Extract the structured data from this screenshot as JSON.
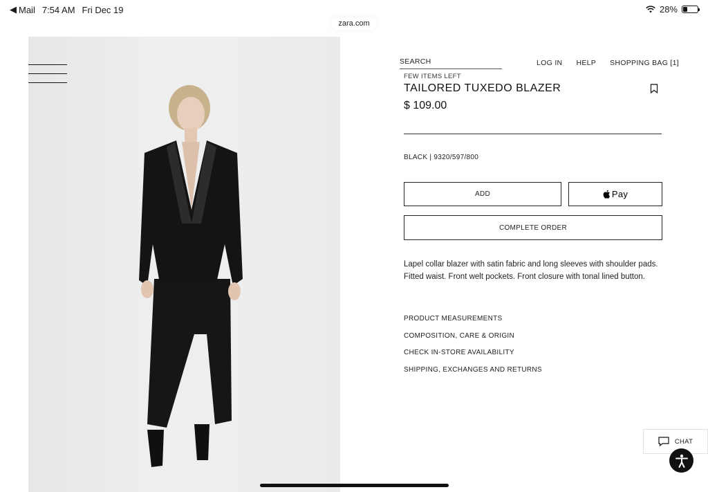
{
  "status_bar": {
    "back_app": "Mail",
    "time": "7:54 AM",
    "date": "Fri Dec 19",
    "battery_percent": "28%",
    "battery_level": 0.28
  },
  "browser": {
    "url": "zara.com"
  },
  "nav": {
    "search_label": "SEARCH",
    "login": "LOG IN",
    "help": "HELP",
    "bag": "SHOPPING BAG [1]"
  },
  "product": {
    "stock_note": "FEW ITEMS LEFT",
    "name": "TAILORED TUXEDO BLAZER",
    "price": "$ 109.00",
    "color_ref": "BLACK | 9320/597/800",
    "description": "Lapel collar blazer with satin fabric and long sleeves with shoulder pads. Fitted waist. Front welt pockets. Front closure with tonal lined button."
  },
  "buttons": {
    "add": "ADD",
    "apple_pay": "Pay",
    "complete_order": "COMPLETE ORDER"
  },
  "info_links": [
    "PRODUCT MEASUREMENTS",
    "COMPOSITION, CARE & ORIGIN",
    "CHECK IN-STORE AVAILABILITY",
    "SHIPPING, EXCHANGES AND RETURNS"
  ],
  "chat": {
    "label": "CHAT"
  },
  "icons": {
    "back": "back-arrow-icon",
    "wifi": "wifi-icon",
    "battery": "battery-icon",
    "menu": "hamburger-menu-icon",
    "bookmark": "bookmark-icon",
    "apple": "apple-logo-icon",
    "chat": "chat-bubble-icon",
    "accessibility": "accessibility-icon"
  },
  "colors": {
    "text": "#1a1a1a",
    "photo_bg": "#ebebeb",
    "blazer": "#141414"
  }
}
